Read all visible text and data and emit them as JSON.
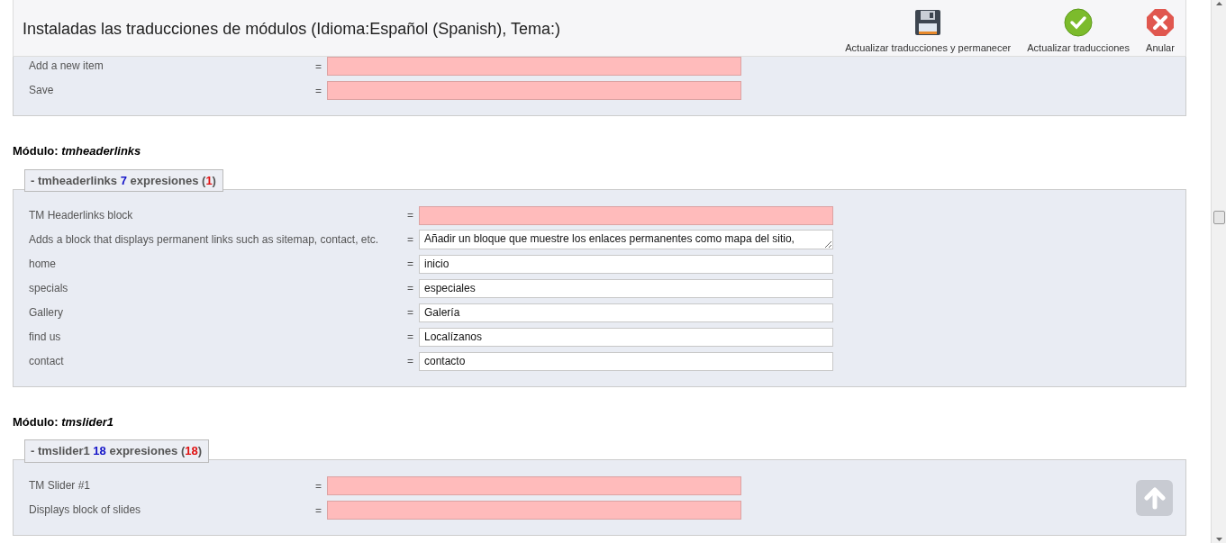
{
  "header": {
    "title": "Instaladas las traducciones de módulos (Idioma:Español (Spanish), Tema:)",
    "actions": [
      {
        "kind": "save",
        "label": "Actualizar traducciones y permanecer"
      },
      {
        "kind": "ok",
        "label": "Actualizar traducciones"
      },
      {
        "kind": "cancel",
        "label": "Anular"
      }
    ]
  },
  "modules": [
    {
      "rows": [
        {
          "kind": "input",
          "label": "Add a new item",
          "value": ""
        },
        {
          "kind": "input",
          "label": "Save",
          "value": ""
        }
      ]
    },
    {
      "heading": "Módulo: *tmheaderlinks*",
      "legend": [
        {
          "kind": "plain",
          "text": "- tmheaderlinks "
        },
        {
          "kind": "count",
          "text": "7"
        },
        {
          "kind": "plain",
          "text": " expresiones ("
        },
        {
          "kind": "missing",
          "text": "1"
        },
        {
          "kind": "plain",
          "text": ")"
        }
      ],
      "rows": [
        {
          "kind": "input",
          "label": "TM Headerlinks block",
          "value": ""
        },
        {
          "kind": "textarea",
          "label": "Adds a block that displays permanent links such as sitemap, contact, etc.",
          "value": "Añadir un bloque que muestre los enlaces permanentes como mapa del sitio,"
        },
        {
          "kind": "input",
          "label": "home",
          "value": "inicio"
        },
        {
          "kind": "input",
          "label": "specials",
          "value": "especiales"
        },
        {
          "kind": "input",
          "label": "Gallery",
          "value": "Galería"
        },
        {
          "kind": "input",
          "label": "find us",
          "value": "Localízanos"
        },
        {
          "kind": "input",
          "label": "contact",
          "value": "contacto"
        }
      ]
    },
    {
      "heading": "Módulo: *tmslider1*",
      "legend": [
        {
          "kind": "plain",
          "text": "- tmslider1 "
        },
        {
          "kind": "count",
          "text": "18"
        },
        {
          "kind": "plain",
          "text": " expresiones ("
        },
        {
          "kind": "missing",
          "text": "18"
        },
        {
          "kind": "plain",
          "text": ")"
        }
      ],
      "rows": [
        {
          "kind": "input",
          "label": "TM Slider #1",
          "value": ""
        },
        {
          "kind": "input",
          "label": "Displays block of slides",
          "value": ""
        }
      ]
    }
  ],
  "equals": "="
}
